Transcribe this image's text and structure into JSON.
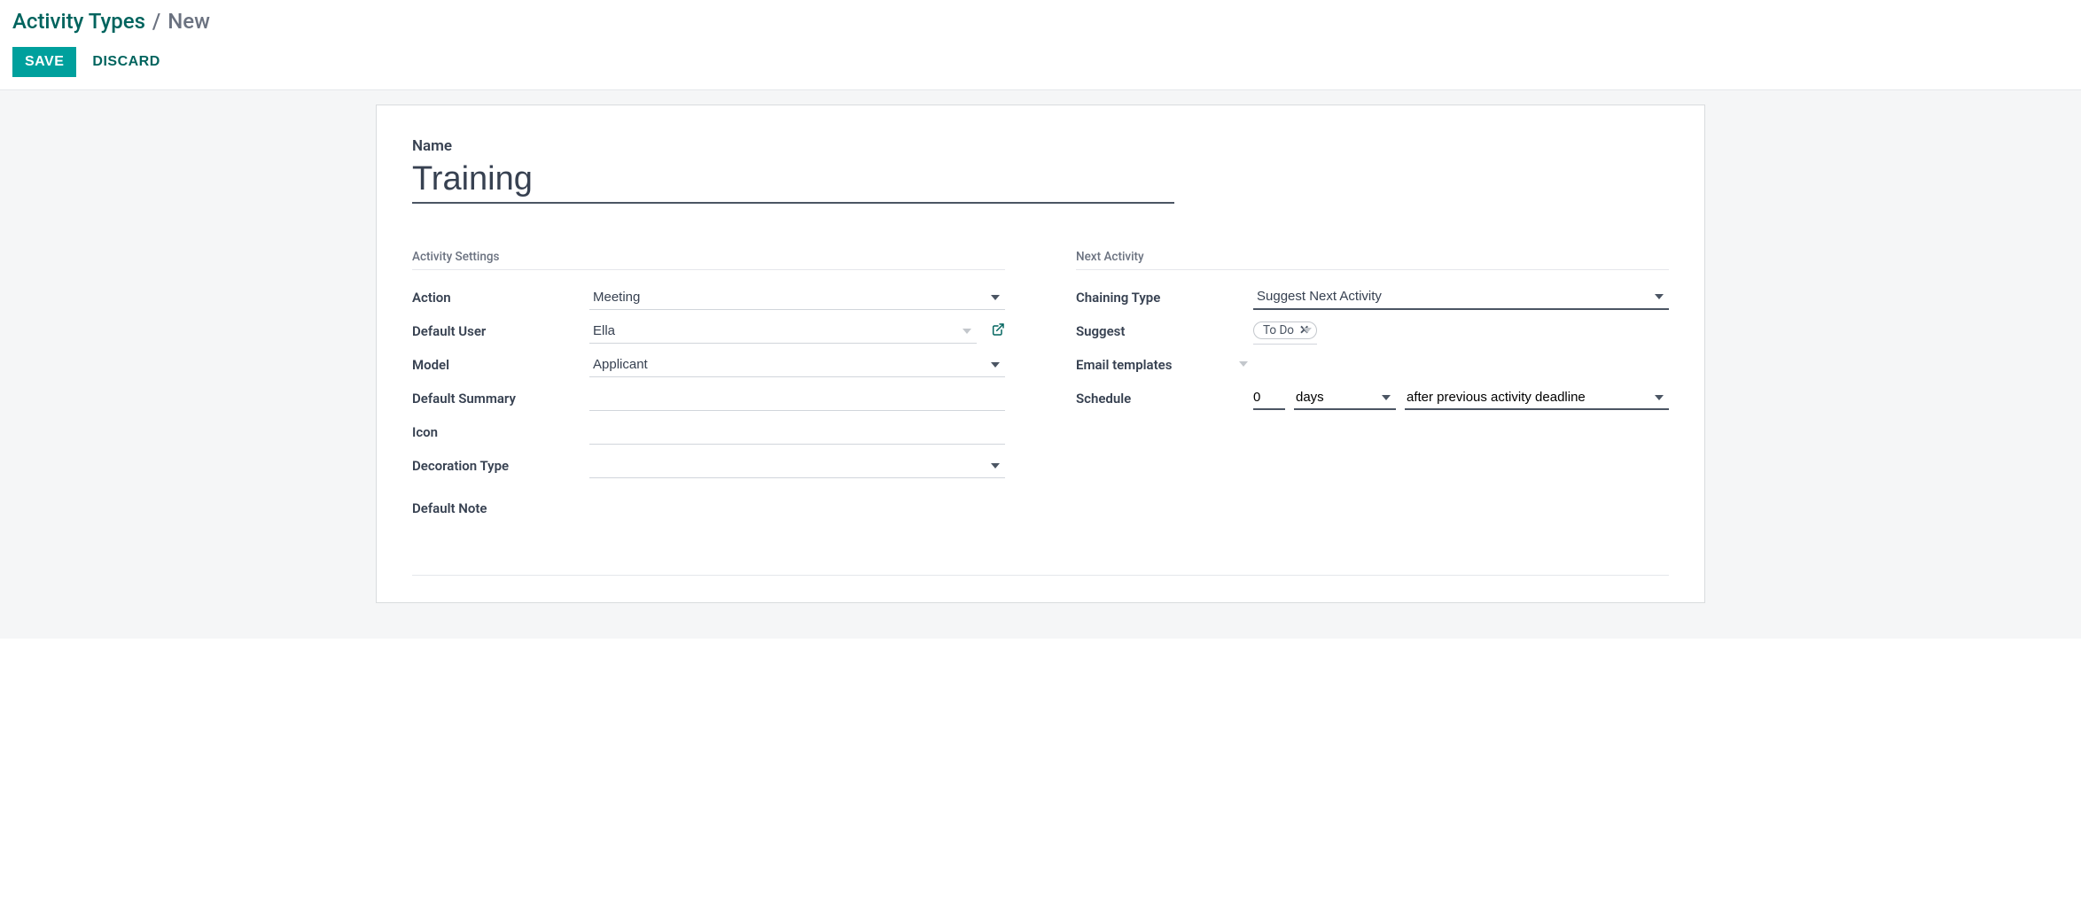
{
  "breadcrumb": {
    "parent": "Activity Types",
    "sep": "/",
    "current": "New"
  },
  "buttons": {
    "save": "SAVE",
    "discard": "DISCARD"
  },
  "form": {
    "name_label": "Name",
    "name_value": "Training",
    "left": {
      "section_title": "Activity Settings",
      "action": {
        "label": "Action",
        "value": "Meeting"
      },
      "default_user": {
        "label": "Default User",
        "value": "Ella"
      },
      "model": {
        "label": "Model",
        "value": "Applicant"
      },
      "default_summary": {
        "label": "Default Summary",
        "value": ""
      },
      "icon": {
        "label": "Icon",
        "value": ""
      },
      "decoration_type": {
        "label": "Decoration Type",
        "value": ""
      },
      "default_note": {
        "label": "Default Note",
        "value": ""
      }
    },
    "right": {
      "section_title": "Next Activity",
      "chaining_type": {
        "label": "Chaining Type",
        "value": "Suggest Next Activity"
      },
      "suggest": {
        "label": "Suggest",
        "tag": "To Do"
      },
      "email_templates": {
        "label": "Email templates",
        "value": ""
      },
      "schedule": {
        "label": "Schedule",
        "count": "0",
        "unit": "days",
        "basis": "after previous activity deadline"
      }
    }
  }
}
